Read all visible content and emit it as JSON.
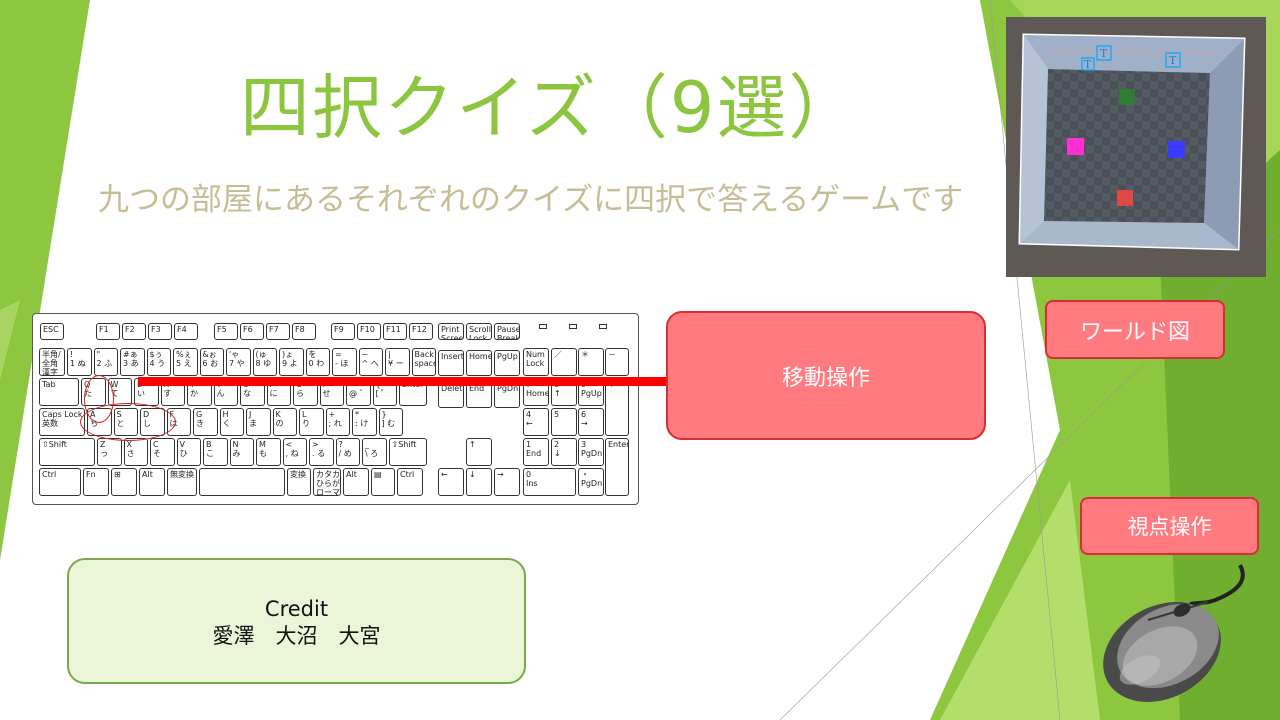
{
  "slide": {
    "title": "四択クイズ（9選）",
    "subtitle": "九つの部屋にあるそれぞれのクイズに四択で答えるゲームです"
  },
  "callouts": {
    "move": "移動操作",
    "world_map": "ワールド図",
    "view": "視点操作"
  },
  "credit": {
    "heading": "Credit",
    "names": "愛澤　大沼　大宮"
  },
  "world_map": {
    "cube_colors": {
      "top": "#2e7d32",
      "left": "#ff2fd6",
      "right": "#3b3bff",
      "bottom": "#e04848"
    },
    "text_markers": [
      "T",
      "T",
      "T"
    ]
  },
  "keyboard": {
    "function_row": [
      "ESC",
      "F1",
      "F2",
      "F3",
      "F4",
      "F5",
      "F6",
      "F7",
      "F8",
      "F9",
      "F10",
      "F11",
      "F12",
      "Print\nScreen",
      "Scroll\nLock",
      "Pause\nBreak"
    ],
    "number_row": [
      "半角/\n全角\n漢字",
      "!\n1 ぬ",
      "\"\n2 ふ",
      "#ぁ\n3 あ",
      "$ぅ\n4 う",
      "%ぇ\n5 え",
      "&ぉ\n6 お",
      "'ゃ\n7 や",
      "(ゅ\n8 ゆ",
      ")ょ\n9 よ",
      "を\n0 わ",
      "=\n- ほ",
      "~\n^ へ",
      "|\n¥ ー",
      "Back\nspace"
    ],
    "q_row": [
      "Tab",
      "Q\nた",
      "W\nて",
      "E\nい",
      "R\nす",
      "T\nか",
      "Y\nん",
      "U\nな",
      "I\nに",
      "O\nら",
      "P\nせ",
      "`\n@ ゛",
      "{\n[ ゜",
      "Enter"
    ],
    "a_row": [
      "Caps Lock\n英数",
      "A\nち",
      "S\nと",
      "D\nし",
      "F\nは",
      "G\nき",
      "H\nく",
      "J\nま",
      "K\nの",
      "L\nり",
      "+\n; れ",
      "*\n: け",
      "}\n] む"
    ],
    "z_row": [
      "⇧Shift",
      "Z\nっ",
      "X\nさ",
      "C\nそ",
      "V\nひ",
      "B\nこ",
      "N\nみ",
      "M\nも",
      "<\n, ね",
      ">\n. る",
      "?\n/ め",
      "_\n\\ ろ",
      "⇧Shift"
    ],
    "bottom_row": [
      "Ctrl",
      "Fn",
      "⊞",
      "Alt",
      "無変換",
      "",
      "変換",
      "カタカナ\nひらがな\nローマ字",
      "Alt",
      "▤",
      "Ctrl"
    ],
    "nav_block": [
      "Insert",
      "Home",
      "PgUp",
      "Delete",
      "End",
      "PgDn"
    ],
    "arrows": [
      "↑",
      "←",
      "↓",
      "→"
    ],
    "numpad": [
      "Num\nLock",
      "／",
      "＊",
      "－",
      "7\nHome",
      "8\n↑",
      "9\nPgUp",
      "+",
      "4\n←",
      "5",
      "6\n→",
      "1\nEnd",
      "2\n↓",
      "3\nPgDn",
      "Enter",
      "0\nIns",
      "・\nPgDn"
    ]
  }
}
